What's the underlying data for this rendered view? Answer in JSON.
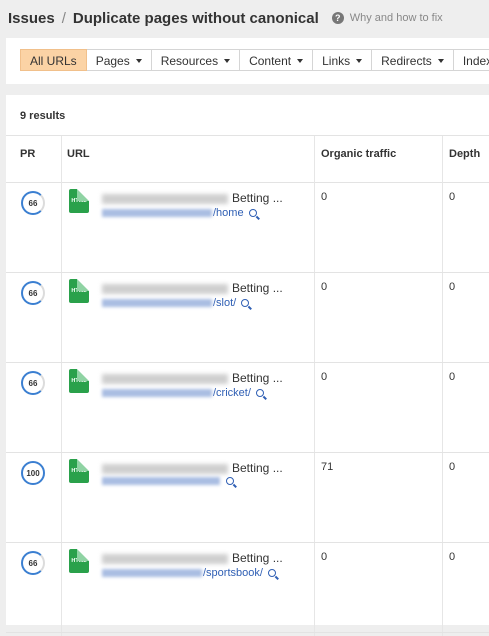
{
  "header": {
    "root": "Issues",
    "separator": "/",
    "title": "Duplicate pages without canonical",
    "help_text": "Why and how to fix"
  },
  "tabs": [
    {
      "label": "All URLs",
      "active": true,
      "dropdown": false
    },
    {
      "label": "Pages",
      "active": false,
      "dropdown": true
    },
    {
      "label": "Resources",
      "active": false,
      "dropdown": true
    },
    {
      "label": "Content",
      "active": false,
      "dropdown": true
    },
    {
      "label": "Links",
      "active": false,
      "dropdown": true
    },
    {
      "label": "Redirects",
      "active": false,
      "dropdown": true
    },
    {
      "label": "Index",
      "active": false,
      "dropdown": false
    }
  ],
  "results_count": "9 results",
  "columns": {
    "pr": "PR",
    "url": "URL",
    "traffic": "Organic traffic",
    "depth": "Depth"
  },
  "rows": [
    {
      "pr": "66",
      "title_visible": "Betting ...",
      "url_visible": "/home",
      "traffic": "0",
      "depth": "0"
    },
    {
      "pr": "66",
      "title_visible": "Betting ...",
      "url_visible": "/slot/",
      "traffic": "0",
      "depth": "0"
    },
    {
      "pr": "66",
      "title_visible": "Betting ...",
      "url_visible": "/cricket/",
      "traffic": "0",
      "depth": "0"
    },
    {
      "pr": "100",
      "title_visible": "Betting ...",
      "url_visible": "",
      "traffic": "71",
      "depth": "0"
    },
    {
      "pr": "66",
      "title_visible": "Betting ...",
      "url_visible": "/sportsbook/",
      "traffic": "0",
      "depth": "0"
    }
  ],
  "icons": {
    "file": "HTML",
    "help": "?"
  },
  "colors": {
    "active_tab": "#fbd3a5",
    "link": "#2f5fb4",
    "pr_ring": "#3b7fd1",
    "file_icon": "#2aa14b"
  }
}
